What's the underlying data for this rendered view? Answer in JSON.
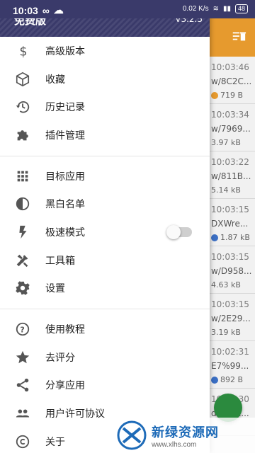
{
  "status_bar": {
    "time": "10:03",
    "right_text": "0.02 K/s",
    "battery": "48"
  },
  "header": {
    "title": "免费版",
    "version": "V3.2.5"
  },
  "menu": {
    "section1": [
      {
        "label": "高级版本",
        "icon": "dollar-icon"
      },
      {
        "label": "收藏",
        "icon": "cube-icon"
      },
      {
        "label": "历史记录",
        "icon": "history-icon"
      },
      {
        "label": "插件管理",
        "icon": "puzzle-icon"
      }
    ],
    "section2": [
      {
        "label": "目标应用",
        "icon": "apps-grid-icon"
      },
      {
        "label": "黑白名单",
        "icon": "contrast-icon"
      },
      {
        "label": "极速模式",
        "icon": "flash-icon",
        "toggle": false
      },
      {
        "label": "工具箱",
        "icon": "tools-icon"
      },
      {
        "label": "设置",
        "icon": "gear-icon"
      }
    ],
    "section3": [
      {
        "label": "使用教程",
        "icon": "help-icon"
      },
      {
        "label": "去评分",
        "icon": "star-icon"
      },
      {
        "label": "分享应用",
        "icon": "share-icon"
      },
      {
        "label": "用户许可协议",
        "icon": "people-icon"
      },
      {
        "label": "关于",
        "icon": "copyright-icon"
      }
    ]
  },
  "background_list": [
    {
      "time": "10:03:46",
      "path": "w/8C2C...",
      "size": "719 B"
    },
    {
      "time": "10:03:34",
      "path": "w/7969...",
      "size": "3.97 kB"
    },
    {
      "time": "10:03:22",
      "path": "w/811B...",
      "size": "5.14 kB"
    },
    {
      "time": "10:03:15",
      "path": "DXWre...",
      "size": "1.87 kB"
    },
    {
      "time": "10:03:15",
      "path": "w/D958...",
      "size": "4.63 kB"
    },
    {
      "time": "10:03:15",
      "path": "w/2E29...",
      "size": "3.19 kB"
    },
    {
      "time": "10:02:31",
      "path": "E7%99...",
      "size": "892 B"
    },
    {
      "time": "10:02:30",
      "path": "d8=3&...",
      "size": ""
    }
  ],
  "watermark": {
    "title": "新绿资源网",
    "url": "www.xlhs.com"
  },
  "colors": {
    "toolbar": "#e69a2e",
    "header": "#3a3a6a",
    "fab": "#2b8a3e"
  }
}
